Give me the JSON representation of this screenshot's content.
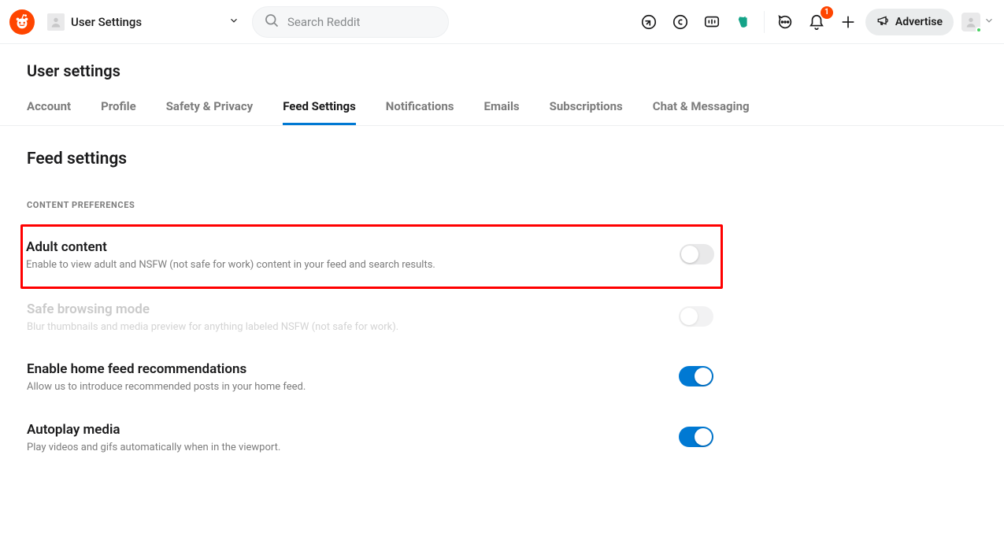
{
  "header": {
    "community_label": "User Settings",
    "search_placeholder": "Search Reddit",
    "advertise_label": "Advertise",
    "notification_badge": "1"
  },
  "page": {
    "title": "User settings",
    "tabs": [
      "Account",
      "Profile",
      "Safety & Privacy",
      "Feed Settings",
      "Notifications",
      "Emails",
      "Subscriptions",
      "Chat & Messaging"
    ],
    "active_tab_index": 3
  },
  "section": {
    "title": "Feed settings",
    "group_label": "CONTENT PREFERENCES",
    "settings": [
      {
        "title": "Adult content",
        "desc": "Enable to view adult and NSFW (not safe for work) content in your feed and search results.",
        "on": false,
        "disabled": false,
        "highlighted": true
      },
      {
        "title": "Safe browsing mode",
        "desc": "Blur thumbnails and media preview for anything labeled NSFW (not safe for work).",
        "on": false,
        "disabled": true,
        "highlighted": false
      },
      {
        "title": "Enable home feed recommendations",
        "desc": "Allow us to introduce recommended posts in your home feed.",
        "on": true,
        "disabled": false,
        "highlighted": false
      },
      {
        "title": "Autoplay media",
        "desc": "Play videos and gifs automatically when in the viewport.",
        "on": true,
        "disabled": false,
        "highlighted": false
      }
    ]
  }
}
